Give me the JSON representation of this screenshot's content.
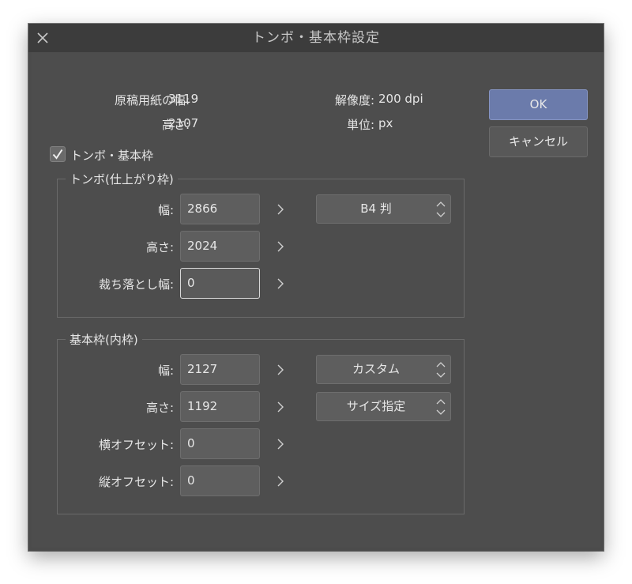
{
  "window": {
    "title": "トンボ・基本枠設定"
  },
  "info": {
    "paper_width_label": "原稿用紙の幅:",
    "paper_width_value": "3119",
    "paper_height_label": "高さ:",
    "paper_height_value": "2107",
    "resolution_label": "解像度:",
    "resolution_value": "200 dpi",
    "unit_label": "単位:",
    "unit_value": "px"
  },
  "buttons": {
    "ok": "OK",
    "cancel": "キャンセル"
  },
  "checkbox": {
    "label": "トンボ・基本枠",
    "checked": true
  },
  "trim": {
    "legend": "トンボ(仕上がり枠)",
    "width_label": "幅:",
    "width_value": "2866",
    "height_label": "高さ:",
    "height_value": "2024",
    "bleed_label": "裁ち落とし幅:",
    "bleed_value": "0",
    "preset": "B4 判"
  },
  "frame": {
    "legend": "基本枠(内枠)",
    "width_label": "幅:",
    "width_value": "2127",
    "height_label": "高さ:",
    "height_value": "1192",
    "h_offset_label": "横オフセット:",
    "h_offset_value": "0",
    "v_offset_label": "縦オフセット:",
    "v_offset_value": "0",
    "preset": "カスタム",
    "size_spec": "サイズ指定"
  },
  "icons": {
    "close": "close-icon",
    "check": "checkmark-icon",
    "arrow": "chevron-right-icon",
    "spinner": "chevron-up-down-icon"
  },
  "colors": {
    "window_bg": "#4d4d4d",
    "titlebar_bg": "#3c3c3c",
    "ok_button": "#6b7bab",
    "field_bg": "#5e5e5e",
    "text": "#e6e6e6"
  }
}
